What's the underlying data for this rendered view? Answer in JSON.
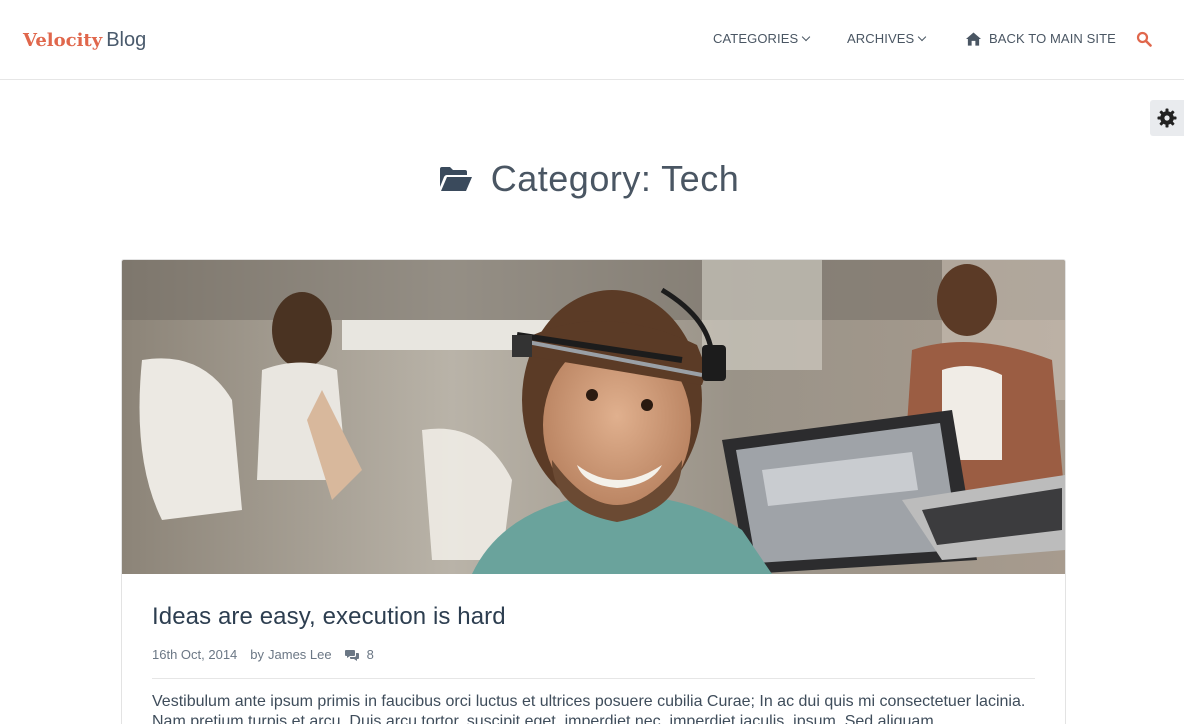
{
  "header": {
    "brand": "Velocity",
    "brand_suffix": "Blog",
    "nav": {
      "categories": "CATEGORIES",
      "archives": "ARCHIVES",
      "back_to_main": "BACK TO MAIN SITE"
    },
    "search_icon": "search-icon"
  },
  "settings": {
    "icon": "gear-icon"
  },
  "page": {
    "icon": "folder-open-icon",
    "title": "Category: Tech"
  },
  "post": {
    "title": "Ideas are easy, execution is hard",
    "date": "16th Oct, 2014",
    "by_label": "by",
    "author": "James Lee",
    "comment_count": "8",
    "excerpt": "Vestibulum ante ipsum primis in faucibus orci luctus et ultrices posuere cubilia Curae; In ac dui quis mi consectetuer lacinia. Nam pretium turpis et arcu. Duis arcu tortor, suscipit eget, imperdiet nec, imperdiet iaculis, ipsum. Sed aliquam"
  },
  "colors": {
    "accent": "#e0674c",
    "text": "#4a5663",
    "title": "#2d3e50"
  }
}
